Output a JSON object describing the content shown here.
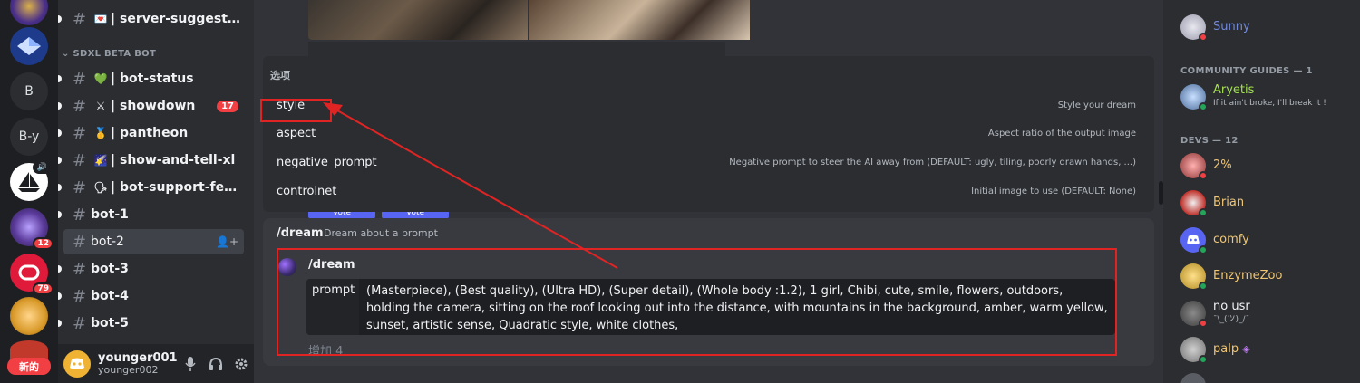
{
  "rail": {
    "servers": [
      {
        "label": "",
        "badge": ""
      },
      {
        "label": "",
        "badge": ""
      },
      {
        "label": "B",
        "badge": ""
      },
      {
        "label": "B-y",
        "badge": ""
      },
      {
        "label": "",
        "badge": ""
      },
      {
        "label": "",
        "badge": "12"
      },
      {
        "label": "",
        "badge": "79"
      },
      {
        "label": "",
        "badge": ""
      }
    ],
    "new_label": "新的"
  },
  "sidebar": {
    "category": "SDXL BETA BOT",
    "channels": [
      {
        "emoji": "💌",
        "name": "| server-suggestions",
        "count": "",
        "bright": true
      },
      {
        "emoji": "💚",
        "name": "| bot-status",
        "count": "",
        "bright": true
      },
      {
        "emoji": "⚔",
        "name": "| showdown",
        "count": "17",
        "bright": true
      },
      {
        "emoji": "🥇",
        "name": "| pantheon",
        "count": "",
        "bright": true
      },
      {
        "emoji": "🌠",
        "name": "| show-and-tell-xl",
        "count": "",
        "bright": true
      },
      {
        "emoji": "🗣",
        "name": "| bot-support-feedb...",
        "count": "",
        "bright": true
      },
      {
        "emoji": "",
        "name": "bot-1",
        "count": "",
        "bright": true
      },
      {
        "emoji": "",
        "name": "bot-2",
        "count": "",
        "bright": false,
        "active": true
      },
      {
        "emoji": "",
        "name": "bot-3",
        "count": "",
        "bright": true
      },
      {
        "emoji": "",
        "name": "bot-4",
        "count": "",
        "bright": true
      },
      {
        "emoji": "",
        "name": "bot-5",
        "count": "",
        "bright": true
      }
    ]
  },
  "user": {
    "name": "younger001",
    "tag": "younger002"
  },
  "main": {
    "vote_labels": [
      "Vote",
      "Vote"
    ],
    "options_header": "选项",
    "options": [
      {
        "name": "style",
        "desc": "Style your dream"
      },
      {
        "name": "aspect",
        "desc": "Aspect ratio of the output image"
      },
      {
        "name": "negative_prompt",
        "desc": "Negative prompt to steer the AI away from (DEFAULT: ugly, tiling, poorly drawn hands, ...)"
      },
      {
        "name": "controlnet",
        "desc": "Initial image to use (DEFAULT: None)"
      }
    ],
    "command_title": "/dream",
    "command_desc": "Dream about a prompt",
    "command_name": "/dream",
    "prompt_key": "prompt",
    "prompt_value": "(Masterpiece), (Best quality), (Ultra HD), (Super detail), (Whole body :1.2), 1 girl, Chibi, cute, smile, flowers, outdoors, holding the camera, sitting on the roof looking out into the distance, with mountains in the background, amber, warm yellow, sunset, artistic sense, Quadratic style, white clothes,",
    "more_label": "增加 4"
  },
  "members": {
    "top": {
      "name": "Sunny",
      "color": "#7289da",
      "status": "dnd"
    },
    "groups": [
      {
        "title": "COMMUNITY GUIDES — 1",
        "members": [
          {
            "name": "Aryetis",
            "sub": "If it ain't broke, I'll break it !",
            "color": "#a3e04d",
            "status": "online"
          }
        ]
      },
      {
        "title": "DEVS — 12",
        "members": [
          {
            "name": "2%",
            "sub": "",
            "color": "#f0c674",
            "status": "dnd"
          },
          {
            "name": "Brian",
            "sub": "",
            "color": "#f0c674",
            "status": "online"
          },
          {
            "name": "comfy",
            "sub": "",
            "color": "#f0c674",
            "status": "online"
          },
          {
            "name": "EnzymeZoo",
            "sub": "",
            "color": "#f0c674",
            "status": "online"
          },
          {
            "name": "no usr",
            "sub": "¯\\_(ツ)_/¯",
            "color": "#f2f3f5",
            "status": "dnd"
          },
          {
            "name": "palp",
            "sub": "",
            "color": "#f0c674",
            "status": "online"
          }
        ]
      }
    ]
  },
  "colors": {
    "annotation": "#e02424",
    "dnd": "#f23f43",
    "online": "#23a55a",
    "accent": "#5865f2"
  }
}
